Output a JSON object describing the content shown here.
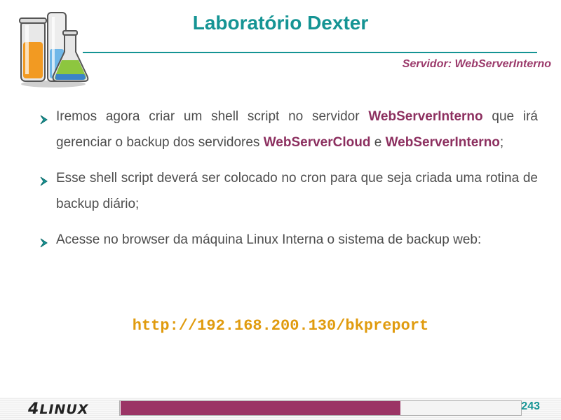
{
  "header": {
    "title": "Laboratório Dexter",
    "server_label": "Servidor: WebServerInterno"
  },
  "bullets": [
    {
      "segments": [
        {
          "text": "Iremos agora criar um shell script no servidor ",
          "hl": false
        },
        {
          "text": "WebServerInterno",
          "hl": true
        },
        {
          "text": " que irá gerenciar o backup dos servidores ",
          "hl": false
        },
        {
          "text": "WebServerCloud",
          "hl": true
        },
        {
          "text": " e ",
          "hl": false
        },
        {
          "text": "WebServerInterno",
          "hl": true
        },
        {
          "text": ";",
          "hl": false
        }
      ]
    },
    {
      "segments": [
        {
          "text": "Esse shell script deverá ser colocado no cron para que seja criada uma rotina de backup diário;",
          "hl": false
        }
      ]
    },
    {
      "segments": [
        {
          "text": "Acesse no browser da máquina Linux Interna o sistema de backup web:",
          "hl": false
        }
      ]
    }
  ],
  "url": "http://192.168.200.130/bkpreport",
  "footer": {
    "brand_digit": "4",
    "brand_text": "LINUX",
    "page_number": "243",
    "progress": 0.7
  },
  "colors": {
    "title": "#159494",
    "highlight": "#8c2f5f",
    "url": "#e09b0e",
    "progress": "#9b3465"
  },
  "icons": {
    "logo": "lab-glassware-icon",
    "bullet": "arrow-bullet-icon"
  }
}
